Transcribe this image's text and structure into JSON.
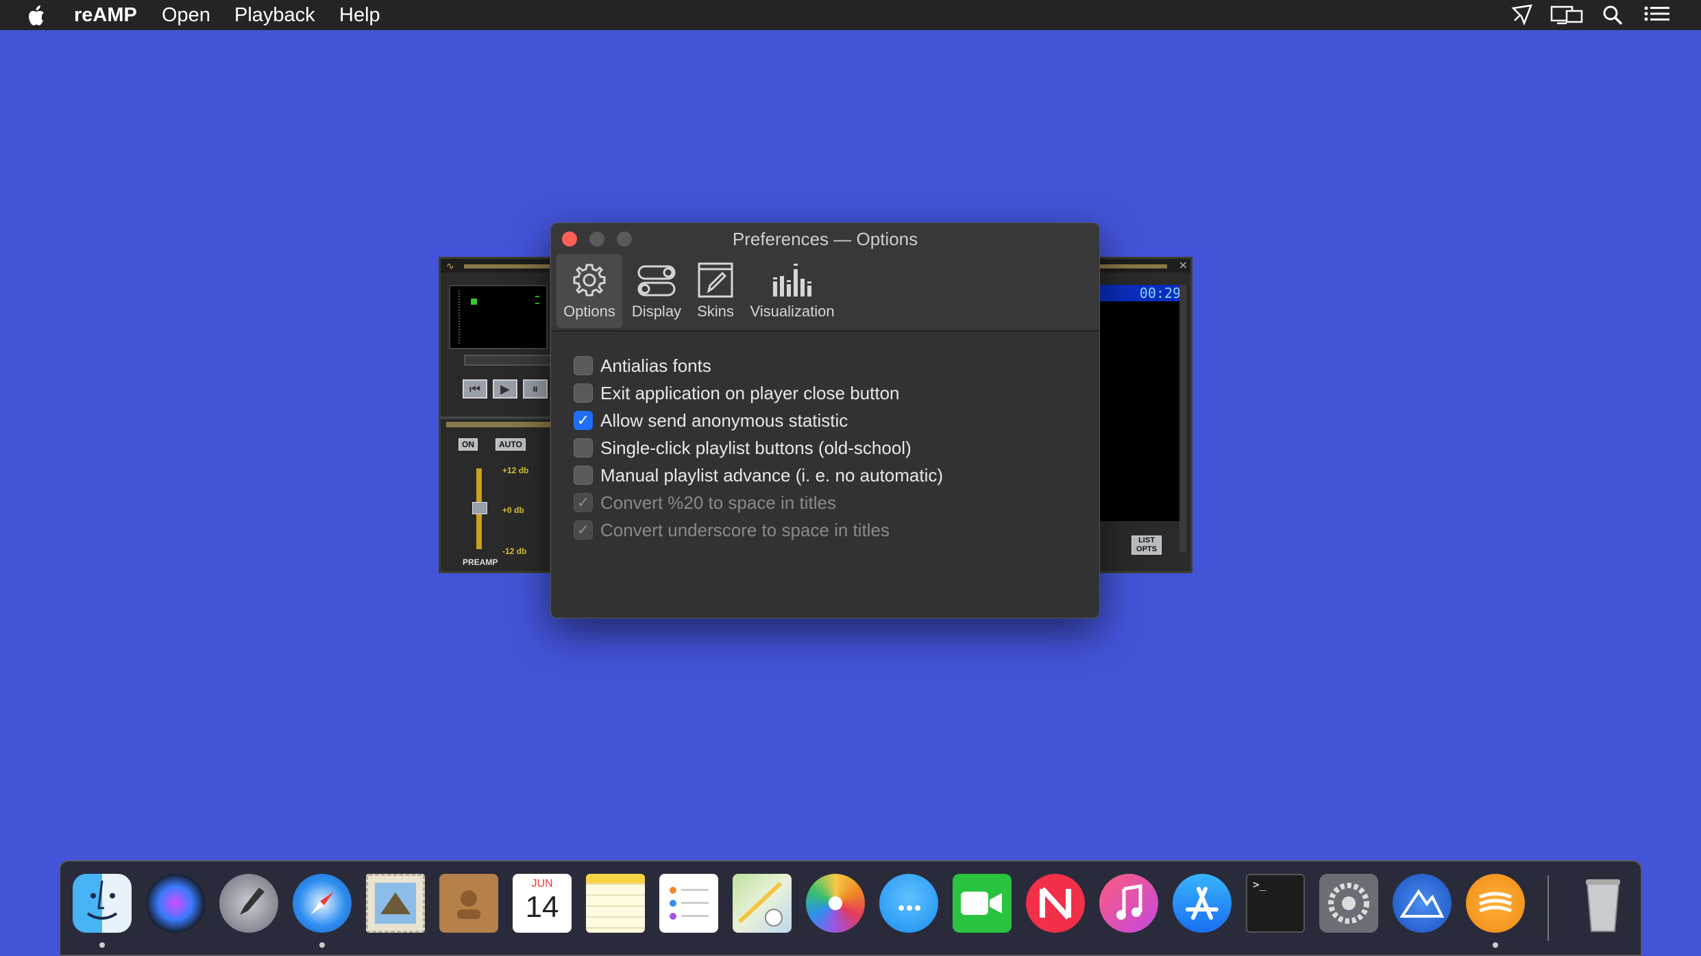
{
  "menubar": {
    "app_name": "reAMP",
    "items": [
      "Open",
      "Playback",
      "Help"
    ]
  },
  "winamp": {
    "time": "00:29",
    "eq_on": "ON",
    "eq_auto": "AUTO",
    "eq_plus": "+12 db",
    "eq_zero": "+0 db",
    "eq_minus": "-12 db",
    "preamp": "PREAMP",
    "list_opts": "LIST OPTS"
  },
  "prefs": {
    "title": "Preferences — Options",
    "tabs": [
      {
        "label": "Options",
        "icon": "gear-icon"
      },
      {
        "label": "Display",
        "icon": "toggles-icon"
      },
      {
        "label": "Skins",
        "icon": "pencil-icon"
      },
      {
        "label": "Visualization",
        "icon": "equalizer-bars-icon"
      }
    ],
    "options": [
      {
        "label": "Antialias fonts",
        "checked": false,
        "disabled": false
      },
      {
        "label": "Exit application on player close button",
        "checked": false,
        "disabled": false
      },
      {
        "label": "Allow send anonymous statistic",
        "checked": true,
        "disabled": false
      },
      {
        "label": "Single-click playlist buttons (old-school)",
        "checked": false,
        "disabled": false
      },
      {
        "label": "Manual playlist advance (i. e. no automatic)",
        "checked": false,
        "disabled": false
      },
      {
        "label": "Convert %20 to space in titles",
        "checked": true,
        "disabled": true
      },
      {
        "label": "Convert underscore to space in titles",
        "checked": true,
        "disabled": true
      }
    ]
  },
  "dock": {
    "calendar_month": "JUN",
    "calendar_day": "14",
    "terminal_prompt": ">_",
    "apps": [
      "finder-icon",
      "siri-icon",
      "launchpad-icon",
      "safari-icon",
      "mail-icon",
      "contacts-icon",
      "calendar-icon",
      "notes-icon",
      "reminders-icon",
      "maps-icon",
      "photos-icon",
      "messages-icon",
      "facetime-icon",
      "news-icon",
      "music-icon",
      "app-store-icon",
      "terminal-icon",
      "system-preferences-icon",
      "altool-icon",
      "reamp-icon",
      "trash-icon"
    ]
  },
  "colors": {
    "desktop": "#4354d9",
    "checkbox_accent": "#1f6ef5",
    "close_red": "#fe5f57"
  }
}
